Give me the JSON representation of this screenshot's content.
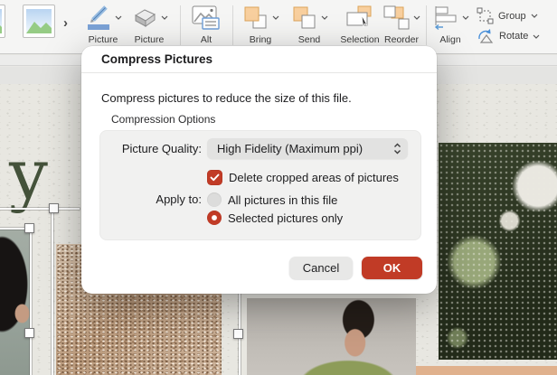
{
  "ribbon": {
    "gallery_more_glyph": "›",
    "buttons": [
      {
        "label": "Picture",
        "icon": "picture-border"
      },
      {
        "label": "Picture",
        "icon": "picture-effects"
      },
      {
        "label": "Alt",
        "icon": "alt-text"
      },
      {
        "label": "Bring",
        "icon": "bring-forward"
      },
      {
        "label": "Send",
        "icon": "send-backward"
      },
      {
        "label": "Selection",
        "icon": "selection-pane"
      },
      {
        "label": "Reorder",
        "icon": "reorder-objects"
      },
      {
        "label": "Align",
        "icon": "align-objects"
      },
      {
        "label": "Group",
        "icon": "group-objects"
      },
      {
        "label": "Rotate",
        "icon": "rotate-objects"
      }
    ]
  },
  "dialog": {
    "title": "Compress Pictures",
    "description": "Compress pictures to reduce the size of this file.",
    "group_label": "Compression Options",
    "picture_quality_label": "Picture Quality:",
    "picture_quality_value": "High Fidelity (Maximum ppi)",
    "delete_cropped_label": "Delete cropped areas of pictures",
    "delete_cropped_checked": true,
    "apply_to_label": "Apply to:",
    "apply_options": [
      {
        "label": "All pictures in this file",
        "selected": false
      },
      {
        "label": "Selected pictures only",
        "selected": true
      }
    ],
    "cancel_label": "Cancel",
    "ok_label": "OK"
  },
  "slide": {
    "title_fragment": "y to"
  },
  "colors": {
    "accent_red": "#c13b26",
    "slide_title_green": "#44523a",
    "orange_strip": "#e0b18d",
    "ribbon_orange": "#f8cf9e",
    "icon_blue": "#5b8fc6"
  }
}
